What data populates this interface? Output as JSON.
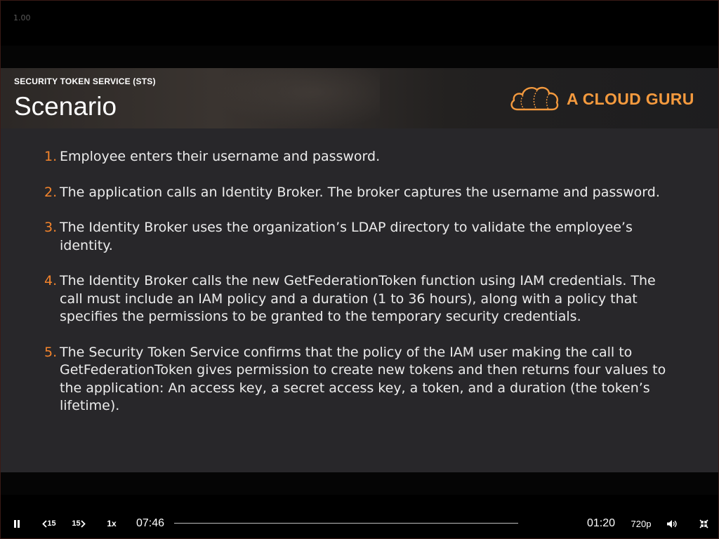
{
  "player": {
    "version_label": "1.00"
  },
  "slide": {
    "section_label": "SECURITY TOKEN SERVICE (STS)",
    "title": "Scenario",
    "brand_name": "A CLOUD GURU",
    "brand_icon": "cloud-logo-icon",
    "accent_color": "#f4842c",
    "steps": [
      {
        "number": "1.",
        "text": "Employee enters their username and password."
      },
      {
        "number": "2.",
        "text": "The application calls an Identity Broker. The broker captures the username and password."
      },
      {
        "number": "3.",
        "text": "The Identity Broker uses the organization’s LDAP directory to validate the employee’s identity."
      },
      {
        "number": "4.",
        "text": "The Identity Broker calls the new GetFederationToken function using IAM credentials. The call must include an IAM policy and a duration (1 to 36 hours), along with a policy that specifies the permissions to be granted to the temporary security credentials."
      },
      {
        "number": "5.",
        "text": "The Security Token Service confirms that the policy of the IAM user making the call to GetFederationToken gives permission to create new tokens and then returns four values to the application: An access key, a secret access key, a token, and a duration (the token’s lifetime)."
      }
    ]
  },
  "controls": {
    "pause_icon": "pause-icon",
    "rewind_label": "15",
    "forward_label": "15",
    "speed_label": "1x",
    "time_elapsed": "07:46",
    "time_remaining": "01:20",
    "progress_fraction": 0.0,
    "quality_label": "720p",
    "volume_icon": "volume-icon",
    "exit_fullscreen_icon": "exit-fullscreen-icon"
  }
}
